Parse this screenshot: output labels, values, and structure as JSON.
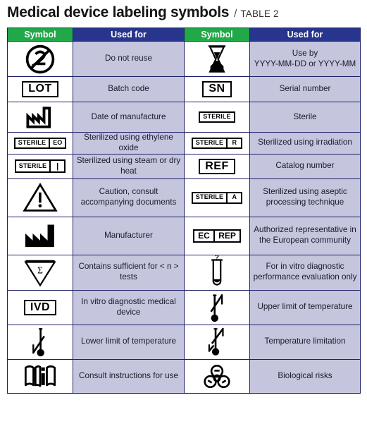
{
  "title": {
    "main": "Medical device labeling symbols",
    "separator": "/",
    "sub": "TABLE 2"
  },
  "colors": {
    "header_symbol_bg": "#21a849",
    "header_usedfor_bg": "#28358c",
    "header_text": "#ffffff",
    "body_text_bg": "#c5c5de",
    "symbol_bg": "#ffffff",
    "border": "#20206a",
    "symbol_ink": "#000000"
  },
  "table": {
    "headers": {
      "symbol_left": "Symbol",
      "usedfor_left": "Used for",
      "symbol_right": "Symbol",
      "usedfor_right": "Used for"
    },
    "rows": [
      {
        "left": {
          "icon": "do-not-reuse-icon",
          "icon_text": "2",
          "label": "Do not reuse"
        },
        "right": {
          "icon": "hourglass-use-by-icon",
          "icon_text": "",
          "label": "Use by\nYYYY-MM-DD or YYYY-MM"
        }
      },
      {
        "left": {
          "icon": "lot-box-icon",
          "icon_text": "LOT",
          "label": "Batch code"
        },
        "right": {
          "icon": "sn-box-icon",
          "icon_text": "SN",
          "label": "Serial number"
        }
      },
      {
        "left": {
          "icon": "factory-date-of-manufacture-icon",
          "icon_text": "",
          "label": "Date of manufacture"
        },
        "right": {
          "icon": "sterile-box-icon",
          "icon_text": "STERILE",
          "label": "Sterile"
        }
      },
      {
        "left": {
          "icon": "sterile-eo-box-icon",
          "icon_text": "STERILE",
          "icon_suffix": "EO",
          "label": "Sterilized using ethylene oxide"
        },
        "right": {
          "icon": "sterile-r-box-icon",
          "icon_text": "STERILE",
          "icon_suffix": "R",
          "label": "Sterilized using irradiation"
        }
      },
      {
        "left": {
          "icon": "sterile-steam-box-icon",
          "icon_text": "STERILE",
          "icon_suffix": "|",
          "label": "Sterilized using steam or dry heat"
        },
        "right": {
          "icon": "ref-box-icon",
          "icon_text": "REF",
          "label": "Catalog number"
        }
      },
      {
        "left": {
          "icon": "caution-triangle-icon",
          "icon_text": "!",
          "label": "Caution, consult accompanying documents"
        },
        "right": {
          "icon": "sterile-a-box-icon",
          "icon_text": "STERILE",
          "icon_suffix": "A",
          "label": "Sterilized using aseptic processing technique"
        }
      },
      {
        "left": {
          "icon": "factory-manufacturer-icon",
          "icon_text": "",
          "label": "Manufacturer"
        },
        "right": {
          "icon": "ec-rep-box-icon",
          "icon_text": "EC REP",
          "label": "Authorized representative in the European community"
        }
      },
      {
        "left": {
          "icon": "sigma-triangle-icon",
          "icon_text": "Σ",
          "label": "Contains sufficient for < n > tests"
        },
        "right": {
          "icon": "test-tube-icon",
          "icon_text": "",
          "label": "For in vitro diagnostic performance evaluation only"
        }
      },
      {
        "left": {
          "icon": "ivd-box-icon",
          "icon_text": "IVD",
          "label": "In vitro diagnostic medical device"
        },
        "right": {
          "icon": "thermometer-upper-limit-icon",
          "icon_text": "",
          "label": "Upper limit of temperature"
        }
      },
      {
        "left": {
          "icon": "thermometer-lower-limit-icon",
          "icon_text": "",
          "label": "Lower limit of temperature"
        },
        "right": {
          "icon": "thermometer-range-icon",
          "icon_text": "",
          "label": "Temperature limitation"
        }
      },
      {
        "left": {
          "icon": "instructions-booklet-icon",
          "icon_text": "",
          "label": "Consult instructions for use"
        },
        "right": {
          "icon": "biohazard-icon",
          "icon_text": "",
          "label": "Biological risks"
        }
      }
    ]
  }
}
